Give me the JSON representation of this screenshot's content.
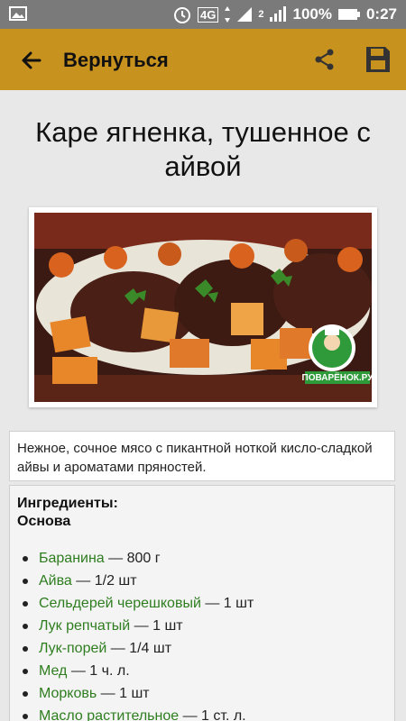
{
  "status_bar": {
    "network": "4G",
    "sim": "2",
    "battery": "100%",
    "time": "0:27"
  },
  "app_bar": {
    "title": "Вернуться",
    "back_icon": "arrow-left-icon",
    "share_icon": "share-icon",
    "save_icon": "save-icon",
    "color": "#c8921f"
  },
  "recipe": {
    "title": "Каре ягненка, тушенное с айвой",
    "photo_watermark": "ПОВАРЁНОК.РУ",
    "description": "Нежное, сочное мясо с пикантной ноткой кисло-сладкой айвы и ароматами пряностей.",
    "ingredients_heading": "Ингредиенты:",
    "section_heading": "Основа",
    "ingredients": [
      {
        "name": "Баранина",
        "amount": " — 800 г"
      },
      {
        "name": "Айва",
        "amount": " — 1/2 шт"
      },
      {
        "name": "Сельдерей черешковый",
        "amount": " — 1 шт"
      },
      {
        "name": "Лук репчатый",
        "amount": " — 1 шт"
      },
      {
        "name": "Лук-порей",
        "amount": " — 1/4 шт"
      },
      {
        "name": "Мед",
        "amount": " — 1 ч. л."
      },
      {
        "name": "Морковь",
        "amount": " — 1 шт"
      },
      {
        "name": "Масло растительное",
        "amount": " — 1 ст. л."
      }
    ]
  }
}
